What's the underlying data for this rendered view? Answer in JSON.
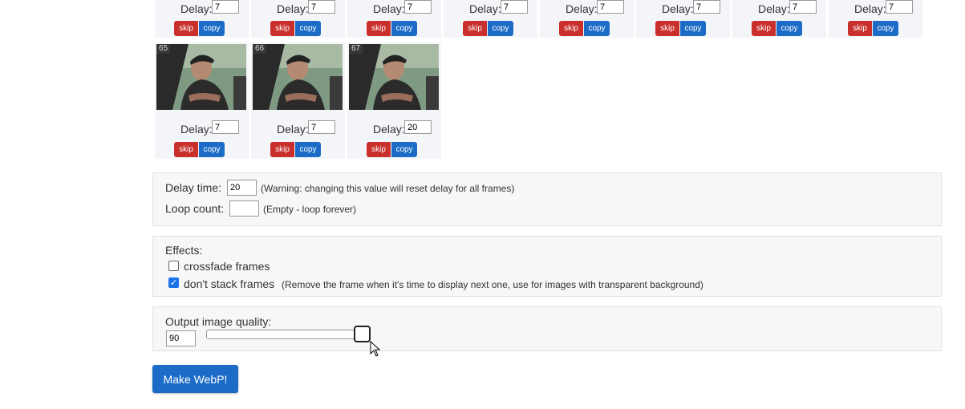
{
  "top_frames": [
    {
      "delay_label": "Delay:",
      "delay_value": "7",
      "skip_label": "skip",
      "copy_label": "copy"
    },
    {
      "delay_label": "Delay:",
      "delay_value": "7",
      "skip_label": "skip",
      "copy_label": "copy"
    },
    {
      "delay_label": "Delay:",
      "delay_value": "7",
      "skip_label": "skip",
      "copy_label": "copy"
    },
    {
      "delay_label": "Delay:",
      "delay_value": "7",
      "skip_label": "skip",
      "copy_label": "copy"
    },
    {
      "delay_label": "Delay:",
      "delay_value": "7",
      "skip_label": "skip",
      "copy_label": "copy"
    },
    {
      "delay_label": "Delay:",
      "delay_value": "7",
      "skip_label": "skip",
      "copy_label": "copy"
    },
    {
      "delay_label": "Delay:",
      "delay_value": "7",
      "skip_label": "skip",
      "copy_label": "copy"
    },
    {
      "delay_label": "Delay:",
      "delay_value": "7",
      "skip_label": "skip",
      "copy_label": "copy"
    }
  ],
  "frames": [
    {
      "number": "65",
      "delay_label": "Delay:",
      "delay_value": "7",
      "skip_label": "skip",
      "copy_label": "copy"
    },
    {
      "number": "66",
      "delay_label": "Delay:",
      "delay_value": "7",
      "skip_label": "skip",
      "copy_label": "copy"
    },
    {
      "number": "67",
      "delay_label": "Delay:",
      "delay_value": "20",
      "skip_label": "skip",
      "copy_label": "copy"
    }
  ],
  "timing": {
    "delay_label": "Delay time:",
    "delay_value": "20",
    "delay_note": "(Warning: changing this value will reset delay for all frames)",
    "loop_label": "Loop count:",
    "loop_value": "",
    "loop_note": "(Empty - loop forever)"
  },
  "effects": {
    "title": "Effects:",
    "crossfade_label": "crossfade frames",
    "crossfade_checked": false,
    "nostack_label": "don't stack frames",
    "nostack_checked": true,
    "nostack_note": "(Remove the frame when it's time to display next one, use for images with transparent background)"
  },
  "quality": {
    "label": "Output image quality:",
    "value": "90",
    "slider_fraction": 0.9
  },
  "make_button_label": "Make WebP!",
  "colors": {
    "skip": "#c9302c",
    "copy": "#1c6cc7",
    "primary": "#1c6cc7",
    "panel": "#f7f7f9"
  }
}
